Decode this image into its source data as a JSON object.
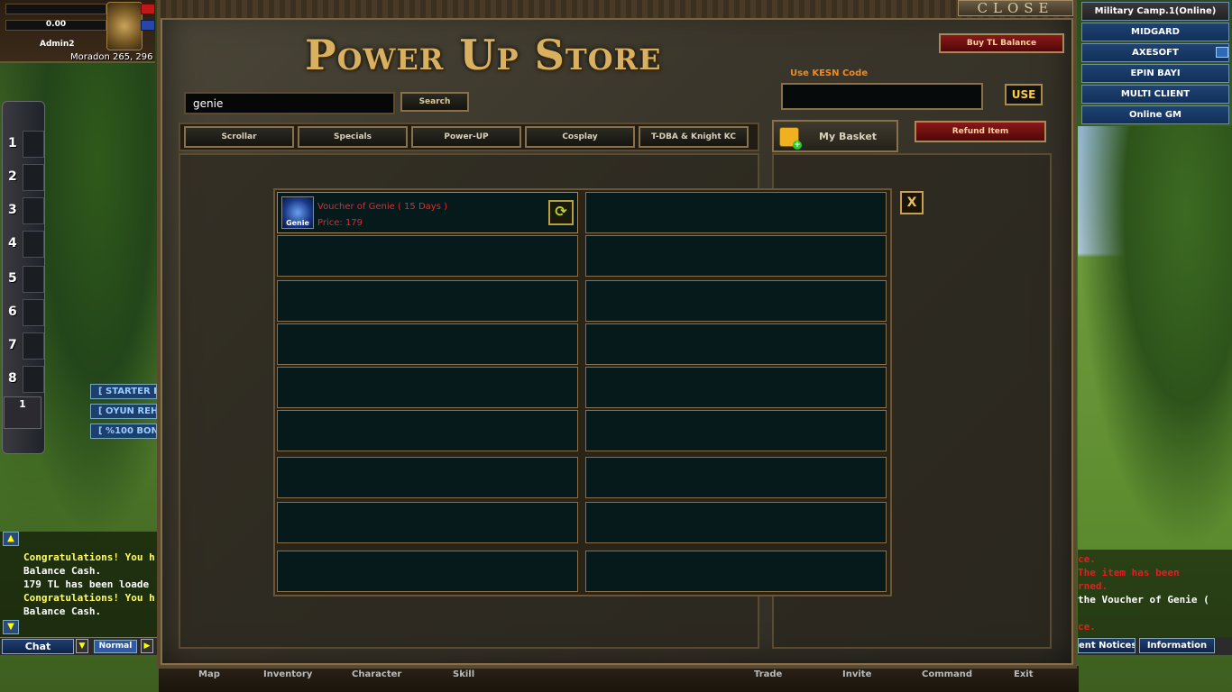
{
  "hud": {
    "hp_value": "0.00",
    "player_name": "Admin2",
    "location": "Moradon 265, 296",
    "hotbar_slots": [
      "1",
      "2",
      "3",
      "4",
      "5",
      "6",
      "7",
      "8"
    ],
    "hotbar_page": "1"
  },
  "side_links": [
    "[ STARTER PA",
    "[ OYUN REHBI",
    "[ %100 BONU"
  ],
  "chat": {
    "lines": [
      "Congratulations! You h",
      "Balance Cash.",
      "179 TL has been loade",
      "Congratulations! You h",
      "Balance Cash."
    ],
    "channel_label": "Chat",
    "mode_label": "Normal"
  },
  "right_list": {
    "items": [
      "Military Camp.1(Online)",
      "MIDGARD",
      "AXESOFT",
      "EPIN BAYI",
      "MULTI CLIENT",
      "Online GM"
    ]
  },
  "right_chat": {
    "lines": [
      "ce.",
      " The item has been",
      "rned.",
      "the Voucher of Genie (",
      "ce."
    ],
    "tabs": [
      "ent Notices",
      "Information"
    ]
  },
  "bottom_bar": [
    "Map",
    "Inventory",
    "Character",
    "Skill",
    "Trade",
    "Invite",
    "Command",
    "Exit"
  ],
  "store": {
    "close_label": "CLOSE",
    "title": "Power Up Store",
    "buy_tl_label": "Buy TL Balance",
    "kesn_label": "Use KESN Code",
    "kesn_value": "",
    "use_label": "USE",
    "search_value": "genie",
    "search_label": "Search",
    "tabs": [
      "Scrollar",
      "Specials",
      "Power-UP",
      "Cosplay",
      "T-DBA & Knight KC"
    ],
    "basket_label": "My Basket",
    "refund_label": "Refund Item",
    "close_x_label": "X",
    "items": [
      {
        "name": "Voucher of Genie ( 15 Days )",
        "price": "Price: 179",
        "icon_text": "Genie"
      }
    ]
  },
  "colors": {
    "item_text": "#e02a2a",
    "title_gold": "#d8b060",
    "kesn_orange": "#f08a20",
    "chat_yellow": "#ffff5a",
    "slot_bg": "#061a1c"
  }
}
